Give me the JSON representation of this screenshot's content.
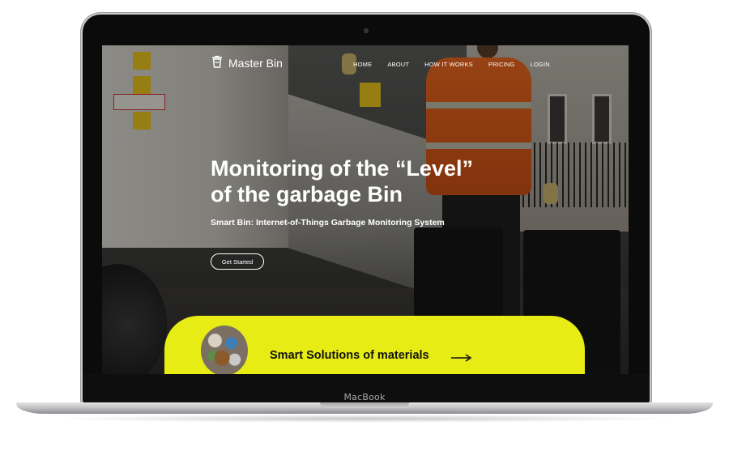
{
  "device": {
    "label": "MacBook"
  },
  "nav": {
    "logo_text": "Master Bin",
    "logo_icon": "bin-icon",
    "links": [
      "HOME",
      "ABOUT",
      "HOW IT WORKS",
      "PRICING",
      "LOGIN"
    ]
  },
  "hero": {
    "title_line1": "Monitoring of the “Level”",
    "title_line2": "of the garbage Bin",
    "subtitle": "Smart Bin: Internet-of-Things Garbage Monitoring System",
    "cta_label": "Get Started"
  },
  "banner": {
    "text": "Smart Solutions of materials",
    "arrow_icon": "arrow-right-icon",
    "background_color": "#e7ec14"
  }
}
